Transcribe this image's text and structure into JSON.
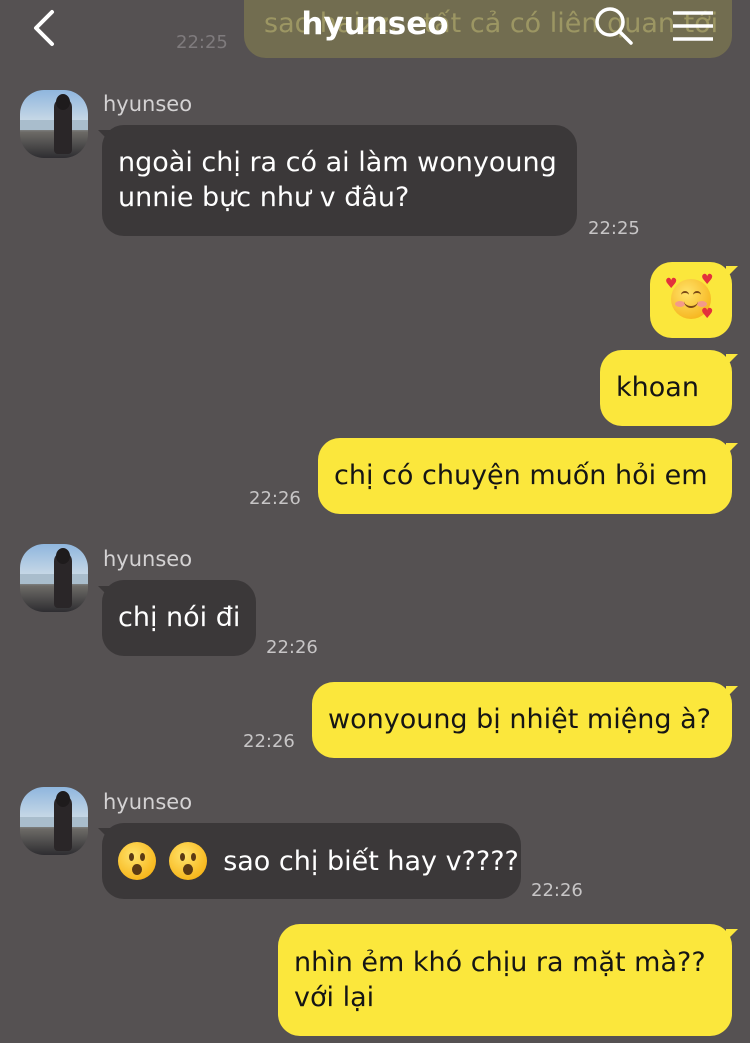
{
  "header": {
    "title": "hyunseo",
    "back_icon": "chevron-left-icon",
    "search_icon": "search-icon",
    "menu_icon": "hamburger-menu-icon"
  },
  "ghost": {
    "text": "sao haizz... tất cả có liên quan tới",
    "time": "22:25"
  },
  "messages": [
    {
      "type": "in",
      "sender": "hyunseo",
      "lines": [
        "ngoài chị ra có ai làm wonyoung",
        "unnie bực như v đâu?"
      ],
      "time": "22:25"
    },
    {
      "type": "out",
      "emoji": "smiling-face-with-hearts",
      "time": ""
    },
    {
      "type": "out",
      "text": "khoan",
      "time": ""
    },
    {
      "type": "out",
      "text": "chị có chuyện muốn hỏi em",
      "time": "22:26"
    },
    {
      "type": "in",
      "sender": "hyunseo",
      "text": "chị nói đi",
      "time": "22:26"
    },
    {
      "type": "out",
      "text": "wonyoung bị nhiệt miệng à?",
      "time": "22:26"
    },
    {
      "type": "in",
      "sender": "hyunseo",
      "emoji": "hushed-face",
      "text": "sao chị biết hay v????",
      "time": "22:26"
    },
    {
      "type": "out",
      "lines": [
        "nhìn ẻm khó chịu ra mặt mà??",
        "với lại"
      ],
      "time": ""
    }
  ],
  "colors": {
    "background": "#555152",
    "incoming_bubble": "#3b3839",
    "outgoing_bubble": "#fbe73c"
  }
}
